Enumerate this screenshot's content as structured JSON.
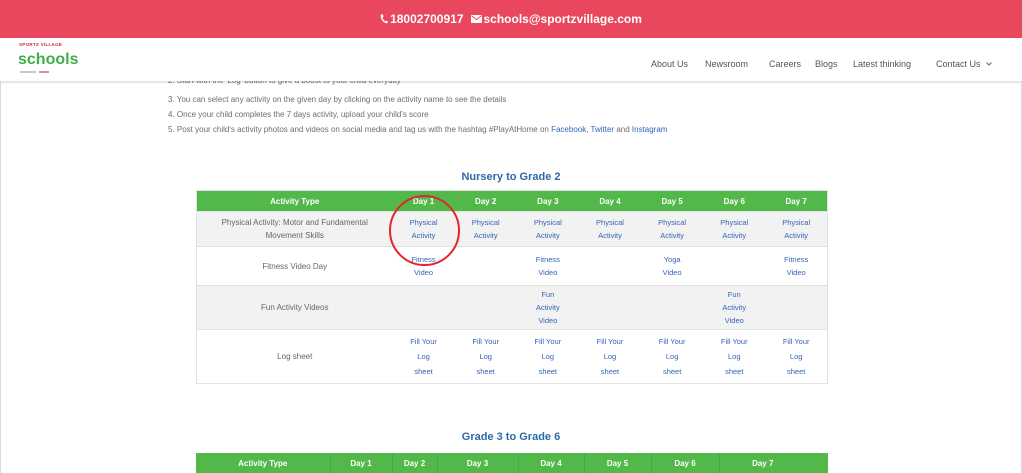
{
  "top_bar": {
    "phone_icon": "phone-icon",
    "phone": "18002700917",
    "email_icon": "mail-icon",
    "email": "schools@sportzvillage.com"
  },
  "logo": {
    "brand": "SPORTZ VILLAGE",
    "name": "schools"
  },
  "nav": {
    "items": [
      "About Us",
      "Newsroom",
      "Careers",
      "Blogs",
      "Latest thinking",
      "Contact Us"
    ],
    "contact_dropdown_icon": "chevron-down-icon"
  },
  "instructions": {
    "items": [
      "2. Start with the 'Log' button to give a boost to your child everyday",
      "3. You can select any activity on the given day by clicking on the activity name to see the details",
      "4. Once your child completes the 7 days activity, upload your child's score"
    ],
    "social": {
      "text": "5. Post your child's activity photos and videos on social media and tag us with the hashtag #PlayAtHome on ",
      "facebook": "Facebook",
      "sep1": ", ",
      "twitter": "Twitter",
      "sep2": " and ",
      "instagram": "Instagram"
    }
  },
  "tables": [
    {
      "heading": "Nursery to Grade 2",
      "columns": [
        "Activity Type",
        "Day 1",
        "Day 2",
        "Day 3",
        "Day 4",
        "Day 5",
        "Day 6",
        "Day 7"
      ],
      "rows": [
        {
          "activity": "Physical Activity: Motor and Fundamental Movement Skills",
          "days": [
            "Physical Activity",
            "Physical Activity",
            "Physical Activity",
            "Physical Activity",
            "Physical Activity",
            "Physical Activity",
            "Physical Activity"
          ]
        },
        {
          "activity": "Fitness Video Day",
          "days": [
            "Fitness Video",
            "",
            "Fitness Video",
            "",
            "Yoga Video",
            "",
            "Fitness Video"
          ]
        },
        {
          "activity": "Fun Activity Videos",
          "days": [
            "",
            "",
            "Fun Activity Video",
            "",
            "",
            "Fun Activity Video",
            ""
          ]
        },
        {
          "activity": "Log sheet",
          "days": [
            "Fill Your Log sheet",
            "Fill Your Log sheet",
            "Fill Your Log sheet",
            "Fill Your Log sheet",
            "Fill Your Log sheet",
            "Fill Your Log sheet",
            "Fill Your Log sheet"
          ]
        }
      ]
    },
    {
      "heading": "Grade 3 to Grade 6",
      "columns": [
        "Activity Type",
        "Day 1",
        "Day 2",
        "Day 3",
        "Day 4",
        "Day 5",
        "Day 6",
        "Day 7"
      ]
    }
  ],
  "colors": {
    "top_bar": "#e8475e",
    "header_green": "#51b849",
    "link_blue": "#3563b8",
    "heading_blue": "#2c6aa8",
    "annotation_red": "#e1262d",
    "logo_green": "#3fae49",
    "logo_red": "#c62a36"
  }
}
